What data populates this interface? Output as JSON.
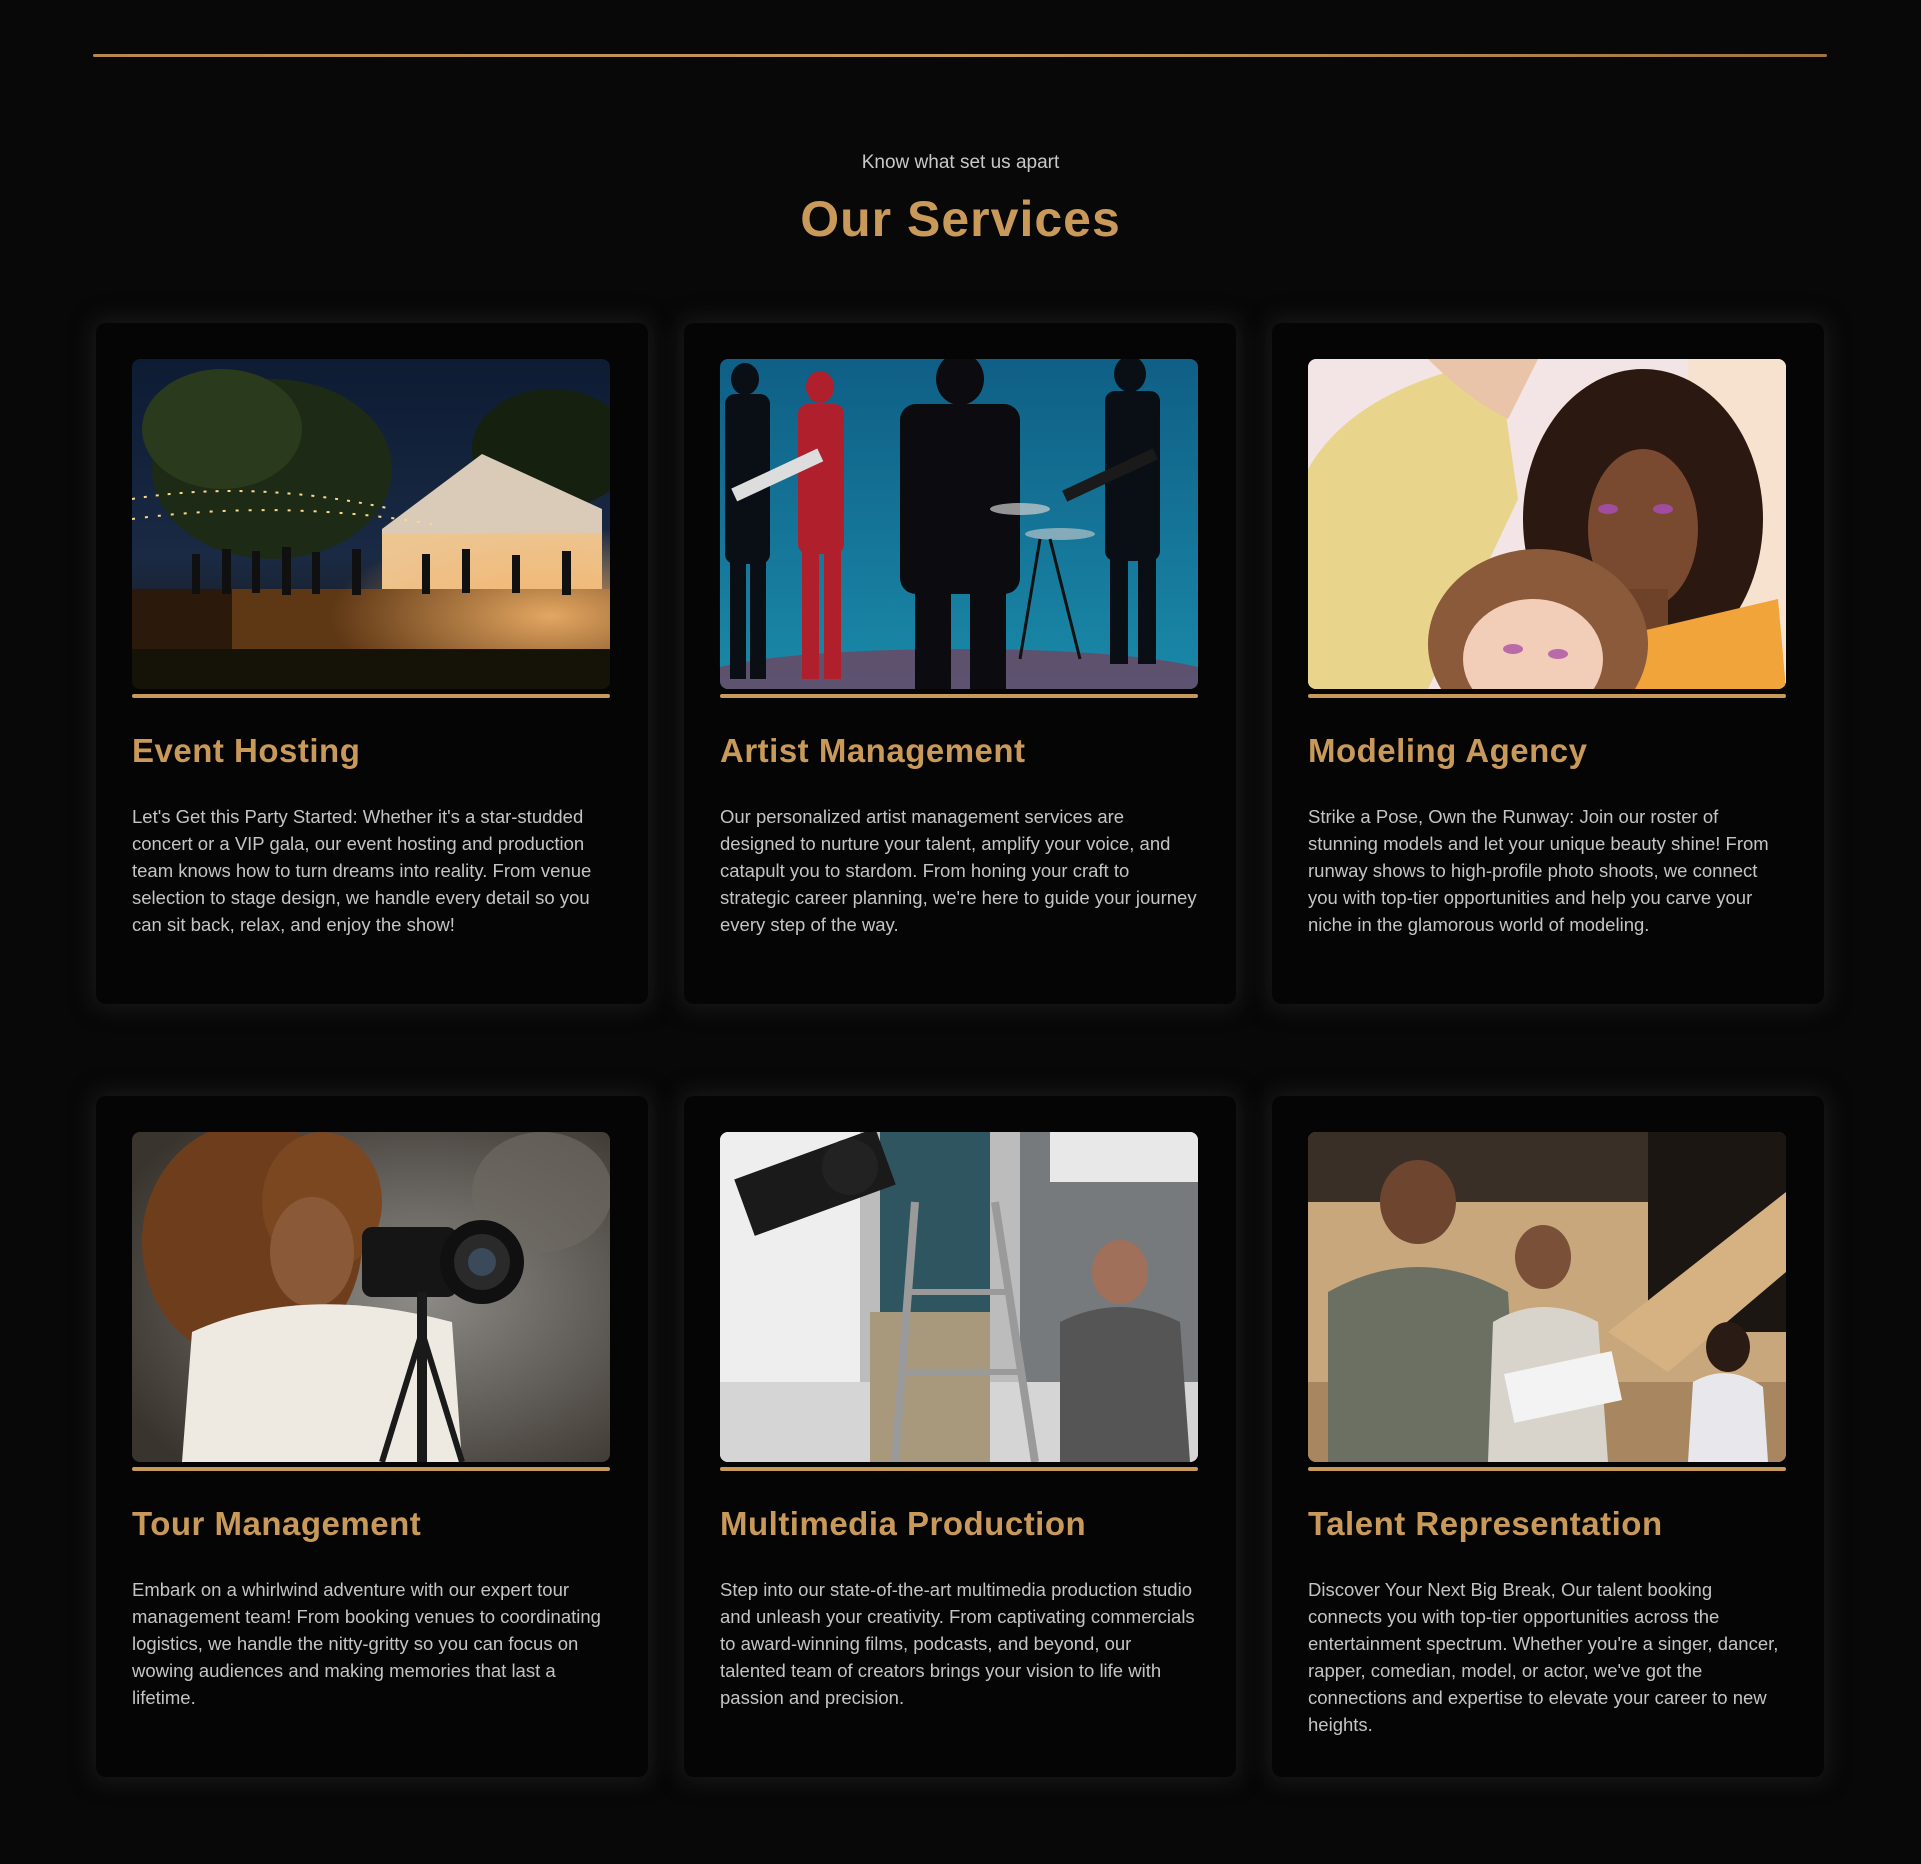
{
  "section": {
    "eyebrow": "Know what set us apart",
    "title": "Our Services"
  },
  "colors": {
    "background": "#080808",
    "accent": "#c9995a",
    "card": "#050505",
    "body_text": "#c4c4c4"
  },
  "services": [
    {
      "image": "outdoor-night-event-photo",
      "title": "Event Hosting",
      "description": "Let's Get this Party Started: Whether it's a star-studded concert or a VIP gala, our event hosting and production team knows how to turn dreams into reality. From venue selection to stage design, we handle every detail so you can sit back, relax, and enjoy the show!"
    },
    {
      "image": "band-performing-photo",
      "title": "Artist Management",
      "description": "Our personalized artist management services are designed to nurture your talent, amplify your voice, and catapult you to stardom. From honing your craft to strategic career planning, we're here to guide your journey every step of the way."
    },
    {
      "image": "models-portrait-photo",
      "title": "Modeling Agency",
      "description": "Strike a Pose, Own the Runway: Join our roster of stunning models and let your unique beauty shine! From runway shows to high-profile photo shoots, we connect you with top-tier opportunities and help you carve your niche in the glamorous world of modeling."
    },
    {
      "image": "photographer-with-camera-photo",
      "title": "Tour Management",
      "description": "Embark on a whirlwind adventure with our expert tour management team! From booking venues to coordinating logistics, we handle the nitty-gritty so you can focus on wowing audiences and making memories that last a lifetime."
    },
    {
      "image": "film-crew-studio-photo",
      "title": "Multimedia Production",
      "description": "Step into our state-of-the-art multimedia production studio and unleash your creativity. From captivating commercials to award-winning films, podcasts, and beyond, our talented team of creators brings your vision to life with passion and precision."
    },
    {
      "image": "actors-rehearsal-photo",
      "title": "Talent Representation",
      "description": "Discover Your Next Big Break, Our talent booking connects you with top-tier opportunities across the entertainment spectrum. Whether you're a singer, dancer, rapper, comedian, model, or actor, we've got the connections and expertise to elevate your career to new heights."
    }
  ]
}
